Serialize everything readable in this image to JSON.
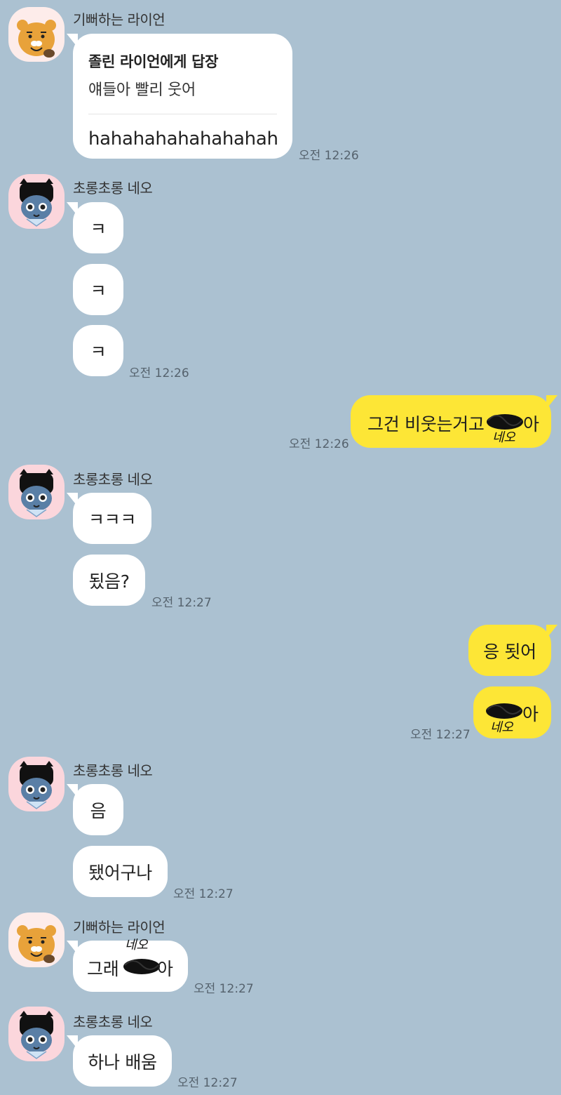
{
  "senders": {
    "ryan": "기뻐하는 라이언",
    "neo": "초롱초롱 네오"
  },
  "msg1": {
    "reply_title": "졸린 라이언에게 답장",
    "reply_quote": "얘들아 빨리 웃어",
    "text": "hahahahahahahahah",
    "time": "오전 12:26"
  },
  "msg2": {
    "lines": [
      "ㅋ",
      "ㅋ",
      "ㅋ"
    ],
    "time": "오전 12:26"
  },
  "msg3": {
    "text": "그건 비웃는거고",
    "suffix": "아",
    "handwriting": "네오",
    "time": "오전 12:26"
  },
  "msg4": {
    "lines": [
      "ㅋㅋㅋ",
      "됬음?"
    ],
    "time": "오전 12:27"
  },
  "msg5": {
    "line1": "응 됫어",
    "suffix": "아",
    "handwriting": "네오",
    "time": "오전 12:27"
  },
  "msg6": {
    "lines": [
      "음",
      "됐어구나"
    ],
    "time": "오전 12:27"
  },
  "msg7": {
    "text": "그래",
    "suffix": "아",
    "handwriting": "네오",
    "time": "오전 12:27"
  },
  "msg8": {
    "text": "하나 배움",
    "time": "오전 12:27"
  }
}
